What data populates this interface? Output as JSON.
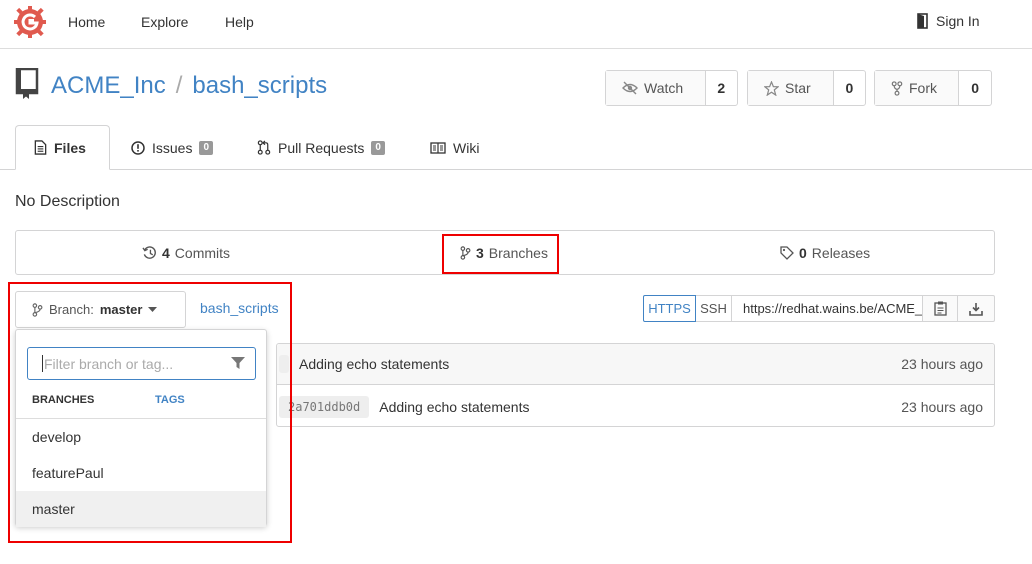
{
  "nav": {
    "home": "Home",
    "explore": "Explore",
    "help": "Help",
    "signin": "Sign In"
  },
  "repo": {
    "owner": "ACME_Inc",
    "name": "bash_scripts",
    "separator": "/"
  },
  "actions": {
    "watch": {
      "label": "Watch",
      "count": "2"
    },
    "star": {
      "label": "Star",
      "count": "0"
    },
    "fork": {
      "label": "Fork",
      "count": "0"
    }
  },
  "tabs": {
    "files": "Files",
    "issues": {
      "label": "Issues",
      "count": "0"
    },
    "pulls": {
      "label": "Pull Requests",
      "count": "0"
    },
    "wiki": "Wiki"
  },
  "description": "No Description",
  "stats": {
    "commits": {
      "count": "4",
      "label": "Commits"
    },
    "branches": {
      "count": "3",
      "label": "Branches"
    },
    "releases": {
      "count": "0",
      "label": "Releases"
    }
  },
  "branch": {
    "prefix": "Branch:",
    "current": "master",
    "breadcrumb": "bash_scripts"
  },
  "clone": {
    "https": "HTTPS",
    "ssh": "SSH",
    "url": "https://redhat.wains.be/ACME_Inc/bash_scripts.git"
  },
  "commits": [
    {
      "sha": "",
      "message": "Adding echo statements",
      "time": "23 hours ago"
    },
    {
      "sha": "2a701ddb0d",
      "message": "Adding echo statements",
      "time": "23 hours ago"
    }
  ],
  "dropdown": {
    "placeholder": "Filter branch or tag...",
    "tab_branches": "BRANCHES",
    "tab_tags": "TAGS",
    "items": [
      "develop",
      "featurePaul",
      "master"
    ]
  },
  "colors": {
    "link": "#4183c4",
    "highlight_box": "#ee0000",
    "logo": "#e05a4f"
  }
}
